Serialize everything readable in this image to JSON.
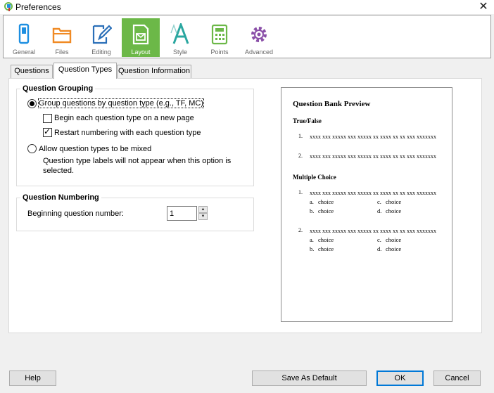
{
  "window": {
    "title": "Preferences",
    "close_glyph": "✕"
  },
  "toolbar": {
    "items": [
      {
        "label": "General",
        "icon": "general-icon"
      },
      {
        "label": "Files",
        "icon": "folder-icon"
      },
      {
        "label": "Editing",
        "icon": "edit-icon"
      },
      {
        "label": "Layout",
        "icon": "layout-icon",
        "active": true
      },
      {
        "label": "Style",
        "icon": "style-icon"
      },
      {
        "label": "Points",
        "icon": "calculator-icon"
      },
      {
        "label": "Advanced",
        "icon": "gear-icon"
      }
    ],
    "colors": {
      "active_bg": "#6cb848",
      "general": "#1d8fe1",
      "files": "#f08a24",
      "editing": "#2a6fb8",
      "style": "#2aa7a0",
      "points": "#6cb848",
      "advanced": "#8a4fa8"
    }
  },
  "tabs": [
    {
      "label": "Questions"
    },
    {
      "label": "Question Types",
      "active": true
    },
    {
      "label": "Question Information"
    }
  ],
  "grouping": {
    "title": "Question Grouping",
    "group_by_type": {
      "label": "Group questions by question type (e.g., TF, MC)",
      "selected": true
    },
    "new_page": {
      "label": "Begin each question type on a new page",
      "checked": false
    },
    "restart_numbering": {
      "label": "Restart numbering with each question type",
      "checked": true
    },
    "allow_mixed": {
      "label": "Allow question types to be mixed",
      "selected": false
    },
    "note_line1": "Question type labels will not appear when this option is",
    "note_line2": "selected."
  },
  "numbering": {
    "title": "Question Numbering",
    "label": "Beginning question number:",
    "value": "1",
    "up_glyph": "▲",
    "down_glyph": "▼"
  },
  "preview": {
    "title": "Question Bank Preview",
    "sections": [
      {
        "label": "True/False"
      },
      {
        "label": "Multiple Choice"
      }
    ],
    "questions": [
      {
        "num": "1.",
        "text": "xxxx xxx xxxxx xxx xxxxx xx xxxx xx xx xxx xxxxxxx"
      },
      {
        "num": "2.",
        "text": "xxxx xxx xxxxx xxx xxxxx xx xxxx xx xx xxx xxxxxxx"
      },
      {
        "num": "1.",
        "text": "xxxx xxx xxxxx xxx xxxxx xx xxxx xx xx xxx xxxxxxx"
      },
      {
        "num": "2.",
        "text": "xxxx xxx xxxxx xxx xxxxx xx xxxx xx xx xxx xxxxxxx"
      }
    ],
    "choices": {
      "a": "a.",
      "b": "b.",
      "c": "c.",
      "d": "d.",
      "word": "choice"
    }
  },
  "buttons": {
    "help": "Help",
    "save_default": "Save As Default",
    "ok": "OK",
    "cancel": "Cancel"
  }
}
